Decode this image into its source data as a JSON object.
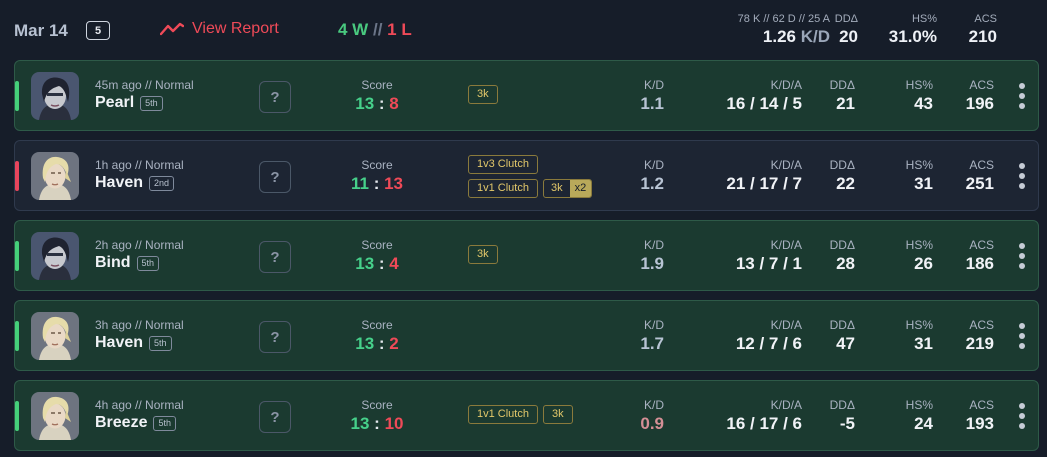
{
  "summary": {
    "date": "Mar 14",
    "count": "5",
    "view_report": "View Report",
    "wins": "4 W",
    "separator": "//",
    "losses": "1 L",
    "kda_totals": "78 K // 62 D // 25 A",
    "kd_value": "1.26",
    "kd_unit": "K/D",
    "dd_label": "DDΔ",
    "dd_value": "20",
    "hs_label": "HS%",
    "hs_value": "31.0%",
    "acs_label": "ACS",
    "acs_value": "210"
  },
  "labels": {
    "score": "Score",
    "kd": "K/D",
    "kda": "K/D/A",
    "dd": "DDΔ",
    "hs": "HS%",
    "acs": "ACS",
    "unknown_agent": "?"
  },
  "colors": {
    "win_accent": "#45d07a",
    "loss_accent": "#e8455c",
    "win_bg": "#1b3a30",
    "loss_bg": "#1d2533",
    "badge_gold": "#e3c86a"
  },
  "matches": [
    {
      "result": "win",
      "agent_icon": "dark-haired-agent-portrait",
      "meta": "45m ago // Normal",
      "map": "Pearl",
      "place": "5th",
      "score_us": "13",
      "score_them": "8",
      "badges_row1": [
        "3k"
      ],
      "badges_row2": [],
      "multi": null,
      "kd": "1.1",
      "kda": "16 / 14 / 5",
      "dd": "21",
      "hs": "43",
      "acs": "196"
    },
    {
      "result": "loss",
      "agent_icon": "blonde-agent-portrait",
      "meta": "1h ago // Normal",
      "map": "Haven",
      "place": "2nd",
      "score_us": "11",
      "score_them": "13",
      "badges_row1": [
        "1v3 Clutch"
      ],
      "badges_row2": [
        "1v1 Clutch"
      ],
      "multi": {
        "label": "3k",
        "mult": "x2"
      },
      "kd": "1.2",
      "kda": "21 / 17 / 7",
      "dd": "22",
      "hs": "31",
      "acs": "251"
    },
    {
      "result": "win",
      "agent_icon": "dark-haired-agent-portrait",
      "meta": "2h ago // Normal",
      "map": "Bind",
      "place": "5th",
      "score_us": "13",
      "score_them": "4",
      "badges_row1": [
        "3k"
      ],
      "badges_row2": [],
      "multi": null,
      "kd": "1.9",
      "kda": "13 / 7 / 1",
      "dd": "28",
      "hs": "26",
      "acs": "186"
    },
    {
      "result": "win",
      "agent_icon": "blonde-agent-portrait",
      "meta": "3h ago // Normal",
      "map": "Haven",
      "place": "5th",
      "score_us": "13",
      "score_them": "2",
      "badges_row1": [],
      "badges_row2": [],
      "multi": null,
      "kd": "1.7",
      "kda": "12 / 7 / 6",
      "dd": "47",
      "hs": "31",
      "acs": "219"
    },
    {
      "result": "win",
      "agent_icon": "blonde-agent-portrait",
      "meta": "4h ago // Normal",
      "map": "Breeze",
      "place": "5th",
      "score_us": "13",
      "score_them": "10",
      "badges_row1": [
        "1v1 Clutch",
        "3k"
      ],
      "badges_row2": [],
      "multi": null,
      "kd": "0.9",
      "kda": "16 / 17 / 6",
      "dd": "-5",
      "hs": "24",
      "acs": "193"
    }
  ]
}
